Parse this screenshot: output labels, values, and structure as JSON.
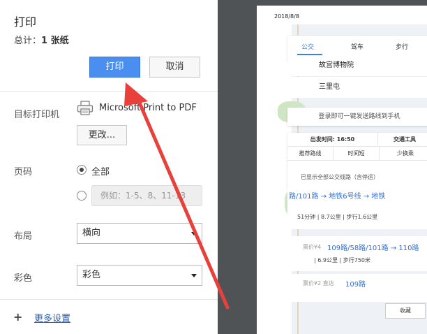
{
  "dialog": {
    "title": "打印",
    "total_label": "总计：",
    "total_value": "1 张纸",
    "print_button": "打印",
    "cancel_button": "取消"
  },
  "destination": {
    "label": "目标打印机",
    "printer_name": "Microsoft Print to PDF",
    "change_button": "更改..."
  },
  "pages": {
    "label": "页码",
    "option_all": "全部",
    "custom_placeholder": "例如：1-5、8、11-13",
    "selected": "全部"
  },
  "layout": {
    "label": "布局",
    "value": "横向"
  },
  "color": {
    "label": "彩色",
    "value": "彩色"
  },
  "more_settings": "更多设置",
  "preview": {
    "date": "2018/8/8",
    "tabs": [
      "公交",
      "驾车",
      "步行"
    ],
    "active_tab": "公交",
    "start": "故宫博物院",
    "end": "三里屯",
    "login_hint": "登录即可一键发送路线到手机",
    "depart_label": "出发时间: 16:50",
    "transport_label": "交通工具",
    "filters": [
      "推荐路线",
      "时间短",
      "少换乘"
    ],
    "filter_note": "已显示全部公交线路（含停运）",
    "routes": [
      {
        "fare": "",
        "line": "路/101路 → 地铁6号线 → 地铁",
        "meta": "51分钟 | 8.7公里 | 步行1.6公里"
      },
      {
        "fare": "票价¥4",
        "line": "109路/58路/101路 → 110路",
        "meta": "| 6.9公里 | 步行750米"
      },
      {
        "fare": "票价¥2 直达",
        "line": "109路",
        "meta": ""
      }
    ],
    "collect_button": "收藏"
  },
  "colors": {
    "primary": "#4a8ef0",
    "link": "#2a5db0",
    "route_blue": "#2f6fd6",
    "preview_background": "#505355",
    "arrow_red": "#e8403a"
  }
}
